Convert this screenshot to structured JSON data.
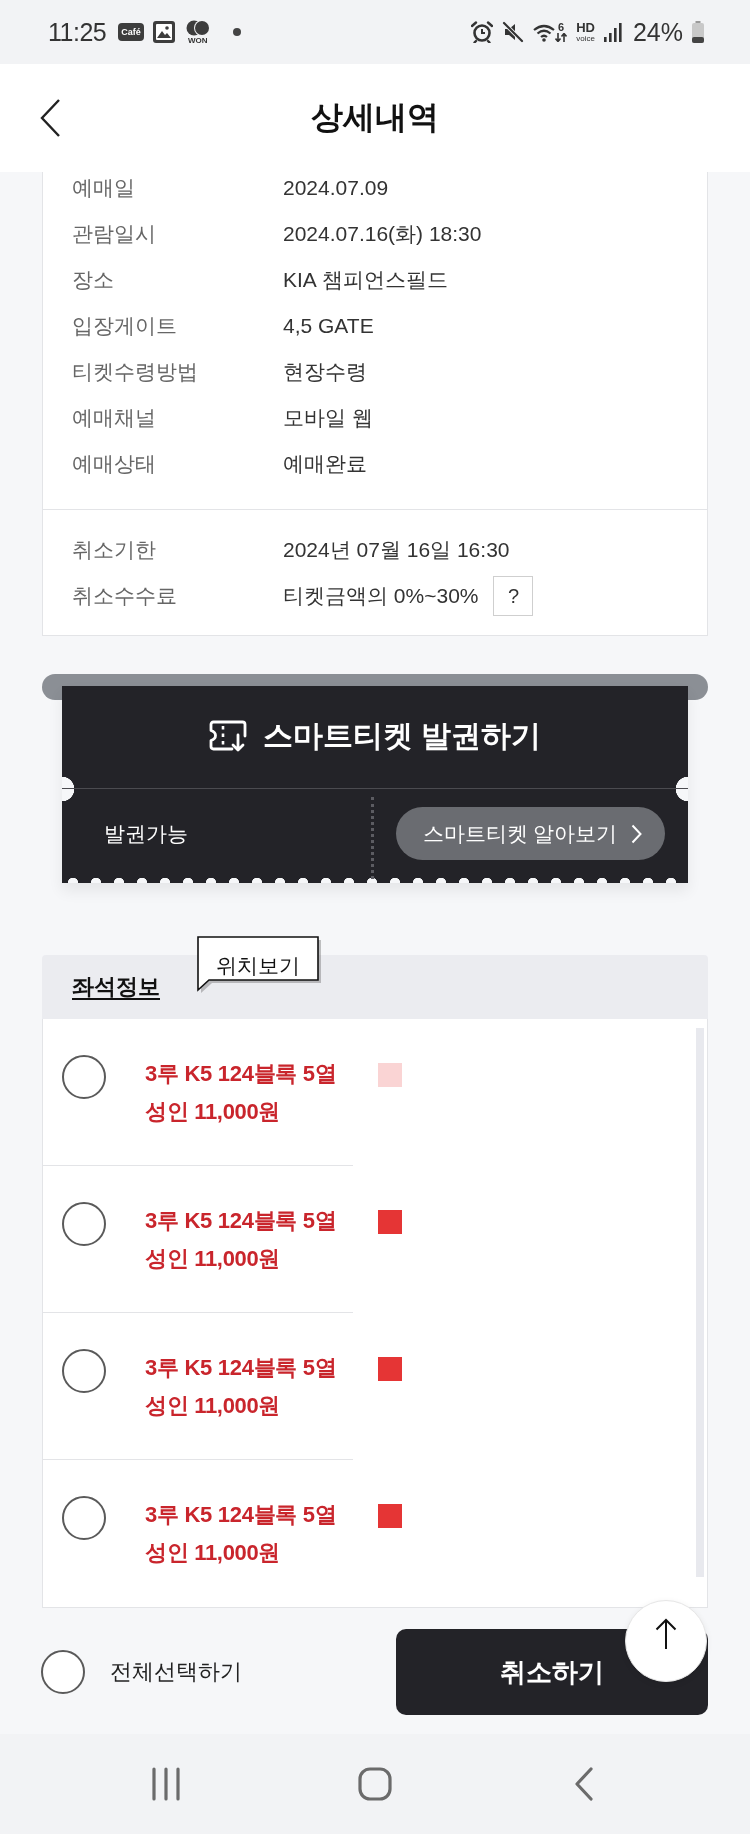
{
  "status_bar": {
    "time": "11:25",
    "notifications": [
      {
        "kind": "badge",
        "label": "Café"
      },
      {
        "kind": "image"
      },
      {
        "kind": "coins",
        "label": "WON"
      },
      {
        "kind": "dot"
      }
    ],
    "wifi_label": "6",
    "hd_voice": {
      "top": "HD",
      "bottom": "voice"
    },
    "battery": "24%"
  },
  "header": {
    "title": "상세내역"
  },
  "booking_info": {
    "details": [
      {
        "label": "예매일",
        "value": "2024.07.09"
      },
      {
        "label": "관람일시",
        "value": "2024.07.16(화) 18:30"
      },
      {
        "label": "장소",
        "value": "KIA 챔피언스필드"
      },
      {
        "label": "입장게이트",
        "value": "4,5 GATE"
      },
      {
        "label": "티켓수령방법",
        "value": "현장수령"
      },
      {
        "label": "예매채널",
        "value": "모바일 웹"
      },
      {
        "label": "예매상태",
        "value": "예매완료"
      }
    ],
    "cancellation": [
      {
        "label": "취소기한",
        "value": "2024년 07월 16일 16:30"
      },
      {
        "label": "취소수수료",
        "value": "티켓금액의 0%~30%",
        "help": "?"
      }
    ]
  },
  "smart_ticket": {
    "title": "스마트티켓 발권하기",
    "status": "발권가능",
    "guide_button": "스마트티켓 알아보기"
  },
  "seat_info": {
    "title": "좌석정보",
    "tooltip": "위치보기",
    "seats": [
      {
        "seat": "3루 K5 124블록 5열",
        "price": "성인 11,000원",
        "selected": false,
        "color": "#fad4d4"
      },
      {
        "seat": "3루 K5 124블록 5열",
        "price": "성인 11,000원",
        "selected": false,
        "color": "#e53535"
      },
      {
        "seat": "3루 K5 124블록 5열",
        "price": "성인 11,000원",
        "selected": false,
        "color": "#e53535"
      },
      {
        "seat": "3루 K5 124블록 5열",
        "price": "성인 11,000원",
        "selected": false,
        "color": "#e53535"
      }
    ]
  },
  "footer": {
    "select_all": {
      "label": "전체선택하기",
      "checked": false
    },
    "cancel_button": "취소하기"
  }
}
